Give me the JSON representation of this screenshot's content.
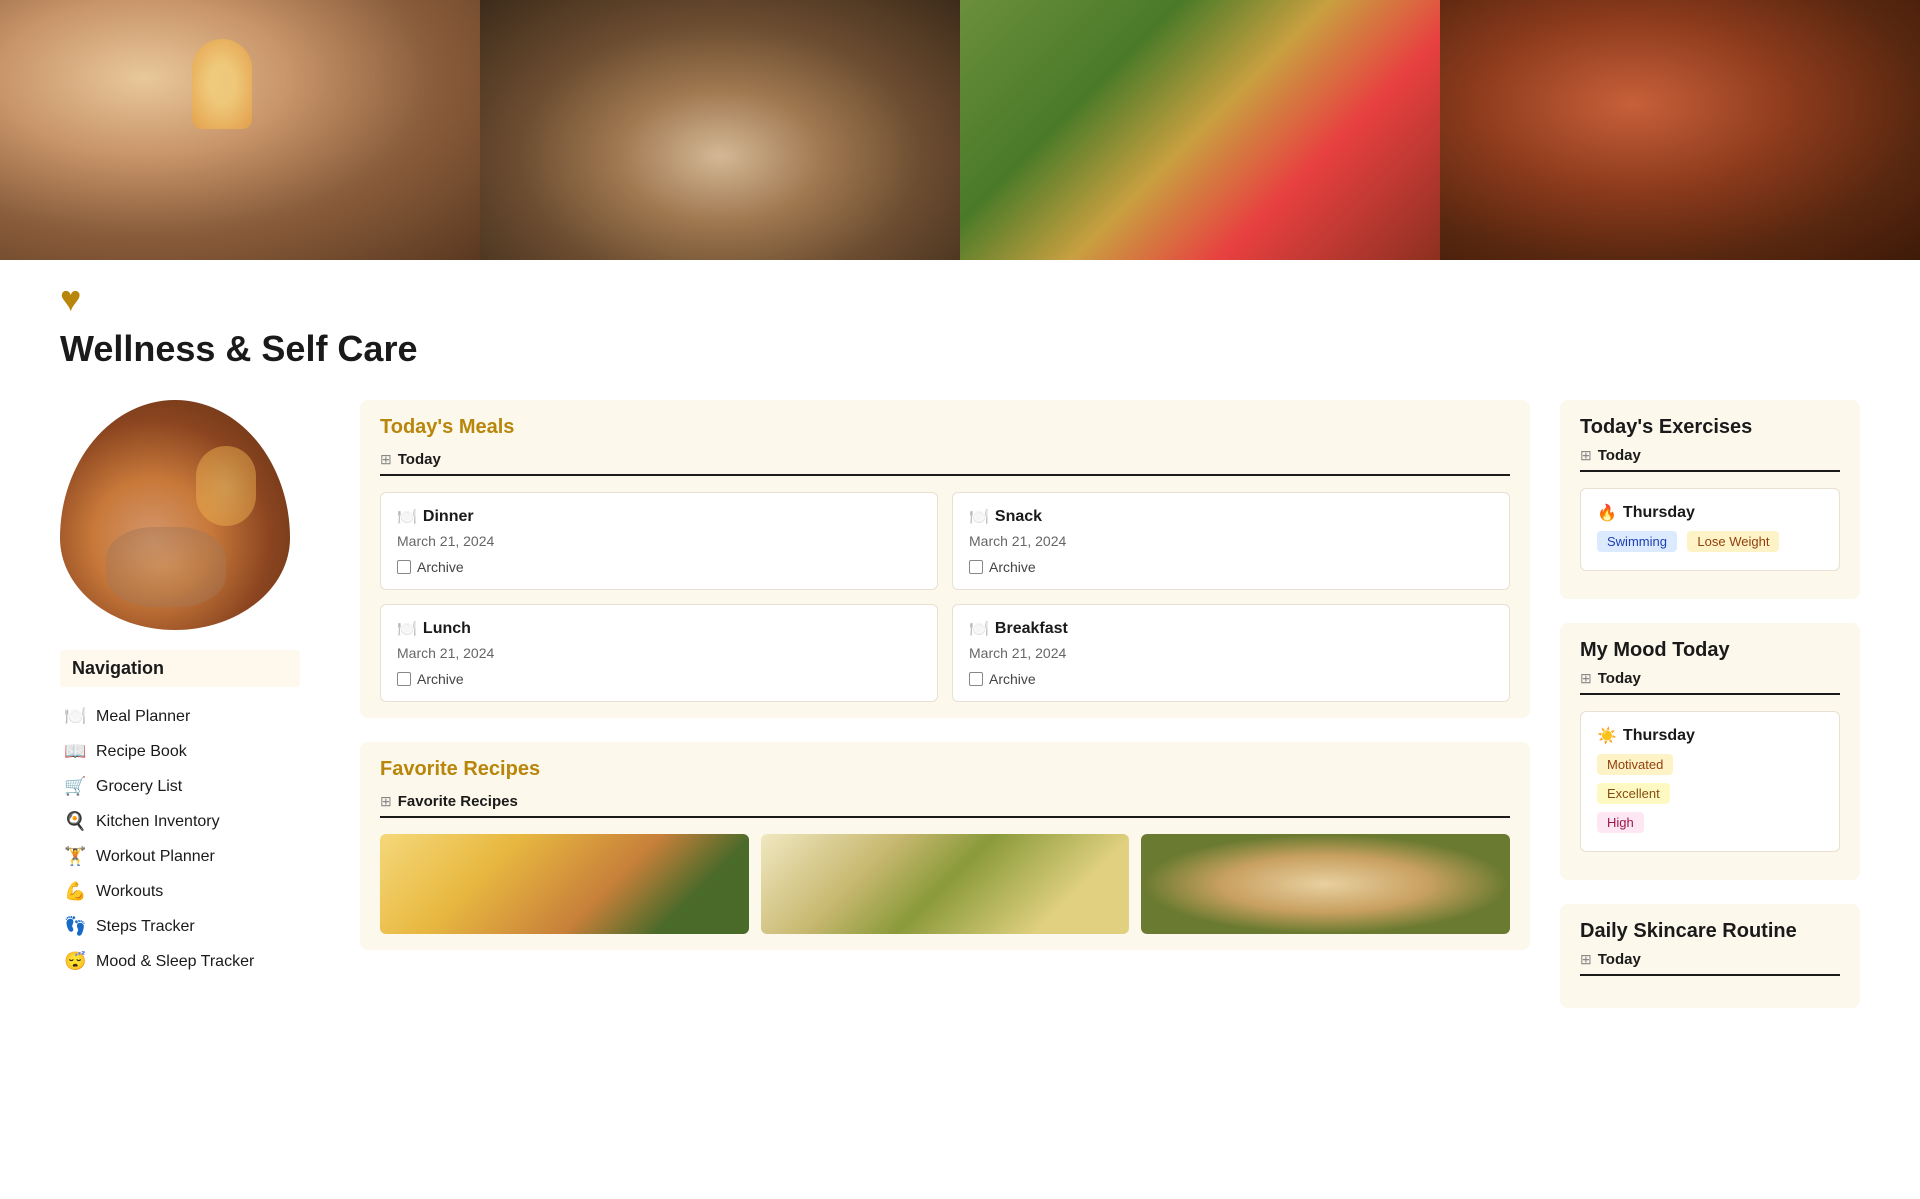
{
  "header": {
    "images": [
      {
        "name": "cozy-flatlay",
        "type": "cozy"
      },
      {
        "name": "tea-book",
        "type": "tea"
      },
      {
        "name": "food-toast",
        "type": "food"
      },
      {
        "name": "autumn-leaves",
        "type": "autumn"
      }
    ]
  },
  "heart": "♥",
  "page_title": "Wellness & Self Care",
  "navigation": {
    "label": "Navigation",
    "items": [
      {
        "icon": "🍽️",
        "label": "Meal Planner",
        "name": "meal-planner"
      },
      {
        "icon": "📖",
        "label": "Recipe Book",
        "name": "recipe-book"
      },
      {
        "icon": "🛒",
        "label": "Grocery List",
        "name": "grocery-list"
      },
      {
        "icon": "🍳",
        "label": "Kitchen Inventory",
        "name": "kitchen-inventory"
      },
      {
        "icon": "🏋️",
        "label": "Workout Planner",
        "name": "workout-planner"
      },
      {
        "icon": "💪",
        "label": "Workouts",
        "name": "workouts"
      },
      {
        "icon": "👣",
        "label": "Steps Tracker",
        "name": "steps-tracker"
      },
      {
        "icon": "😴",
        "label": "Mood & Sleep Tracker",
        "name": "mood-sleep-tracker"
      }
    ]
  },
  "meals_section": {
    "title": "Today's Meals",
    "tab_label": "Today",
    "tab_icon": "⊞",
    "cards": [
      {
        "icon": "🍽️",
        "title": "Dinner",
        "date": "March 21, 2024",
        "archive_label": "Archive"
      },
      {
        "icon": "🍽️",
        "title": "Snack",
        "date": "March 21, 2024",
        "archive_label": "Archive"
      },
      {
        "icon": "🍽️",
        "title": "Lunch",
        "date": "March 21, 2024",
        "archive_label": "Archive"
      },
      {
        "icon": "🍽️",
        "title": "Breakfast",
        "date": "March 21, 2024",
        "archive_label": "Archive"
      }
    ]
  },
  "recipes_section": {
    "title": "Favorite Recipes",
    "tab_label": "Favorite Recipes",
    "tab_icon": "⊞",
    "images": [
      {
        "name": "bowl-berries",
        "type": "bowl"
      },
      {
        "name": "rice-dish",
        "type": "rice"
      },
      {
        "name": "quiche",
        "type": "quiche"
      }
    ]
  },
  "exercises_section": {
    "title": "Today's Exercises",
    "tab_label": "Today",
    "tab_icon": "⊞",
    "card": {
      "day": "Thursday",
      "day_icon": "🔥",
      "tags": [
        {
          "label": "Swimming",
          "type": "blue"
        },
        {
          "label": "Lose Weight",
          "type": "amber"
        }
      ]
    }
  },
  "mood_section": {
    "title": "My Mood Today",
    "tab_label": "Today",
    "tab_icon": "⊞",
    "card": {
      "day": "Thursday",
      "day_icon": "☀️",
      "tags": [
        {
          "label": "Motivated",
          "type": "amber"
        },
        {
          "label": "Excellent",
          "type": "yellow"
        },
        {
          "label": "High",
          "type": "pink"
        }
      ]
    }
  },
  "skincare_section": {
    "title": "Daily Skincare Routine",
    "tab_label": "Today",
    "tab_icon": "⊞"
  }
}
